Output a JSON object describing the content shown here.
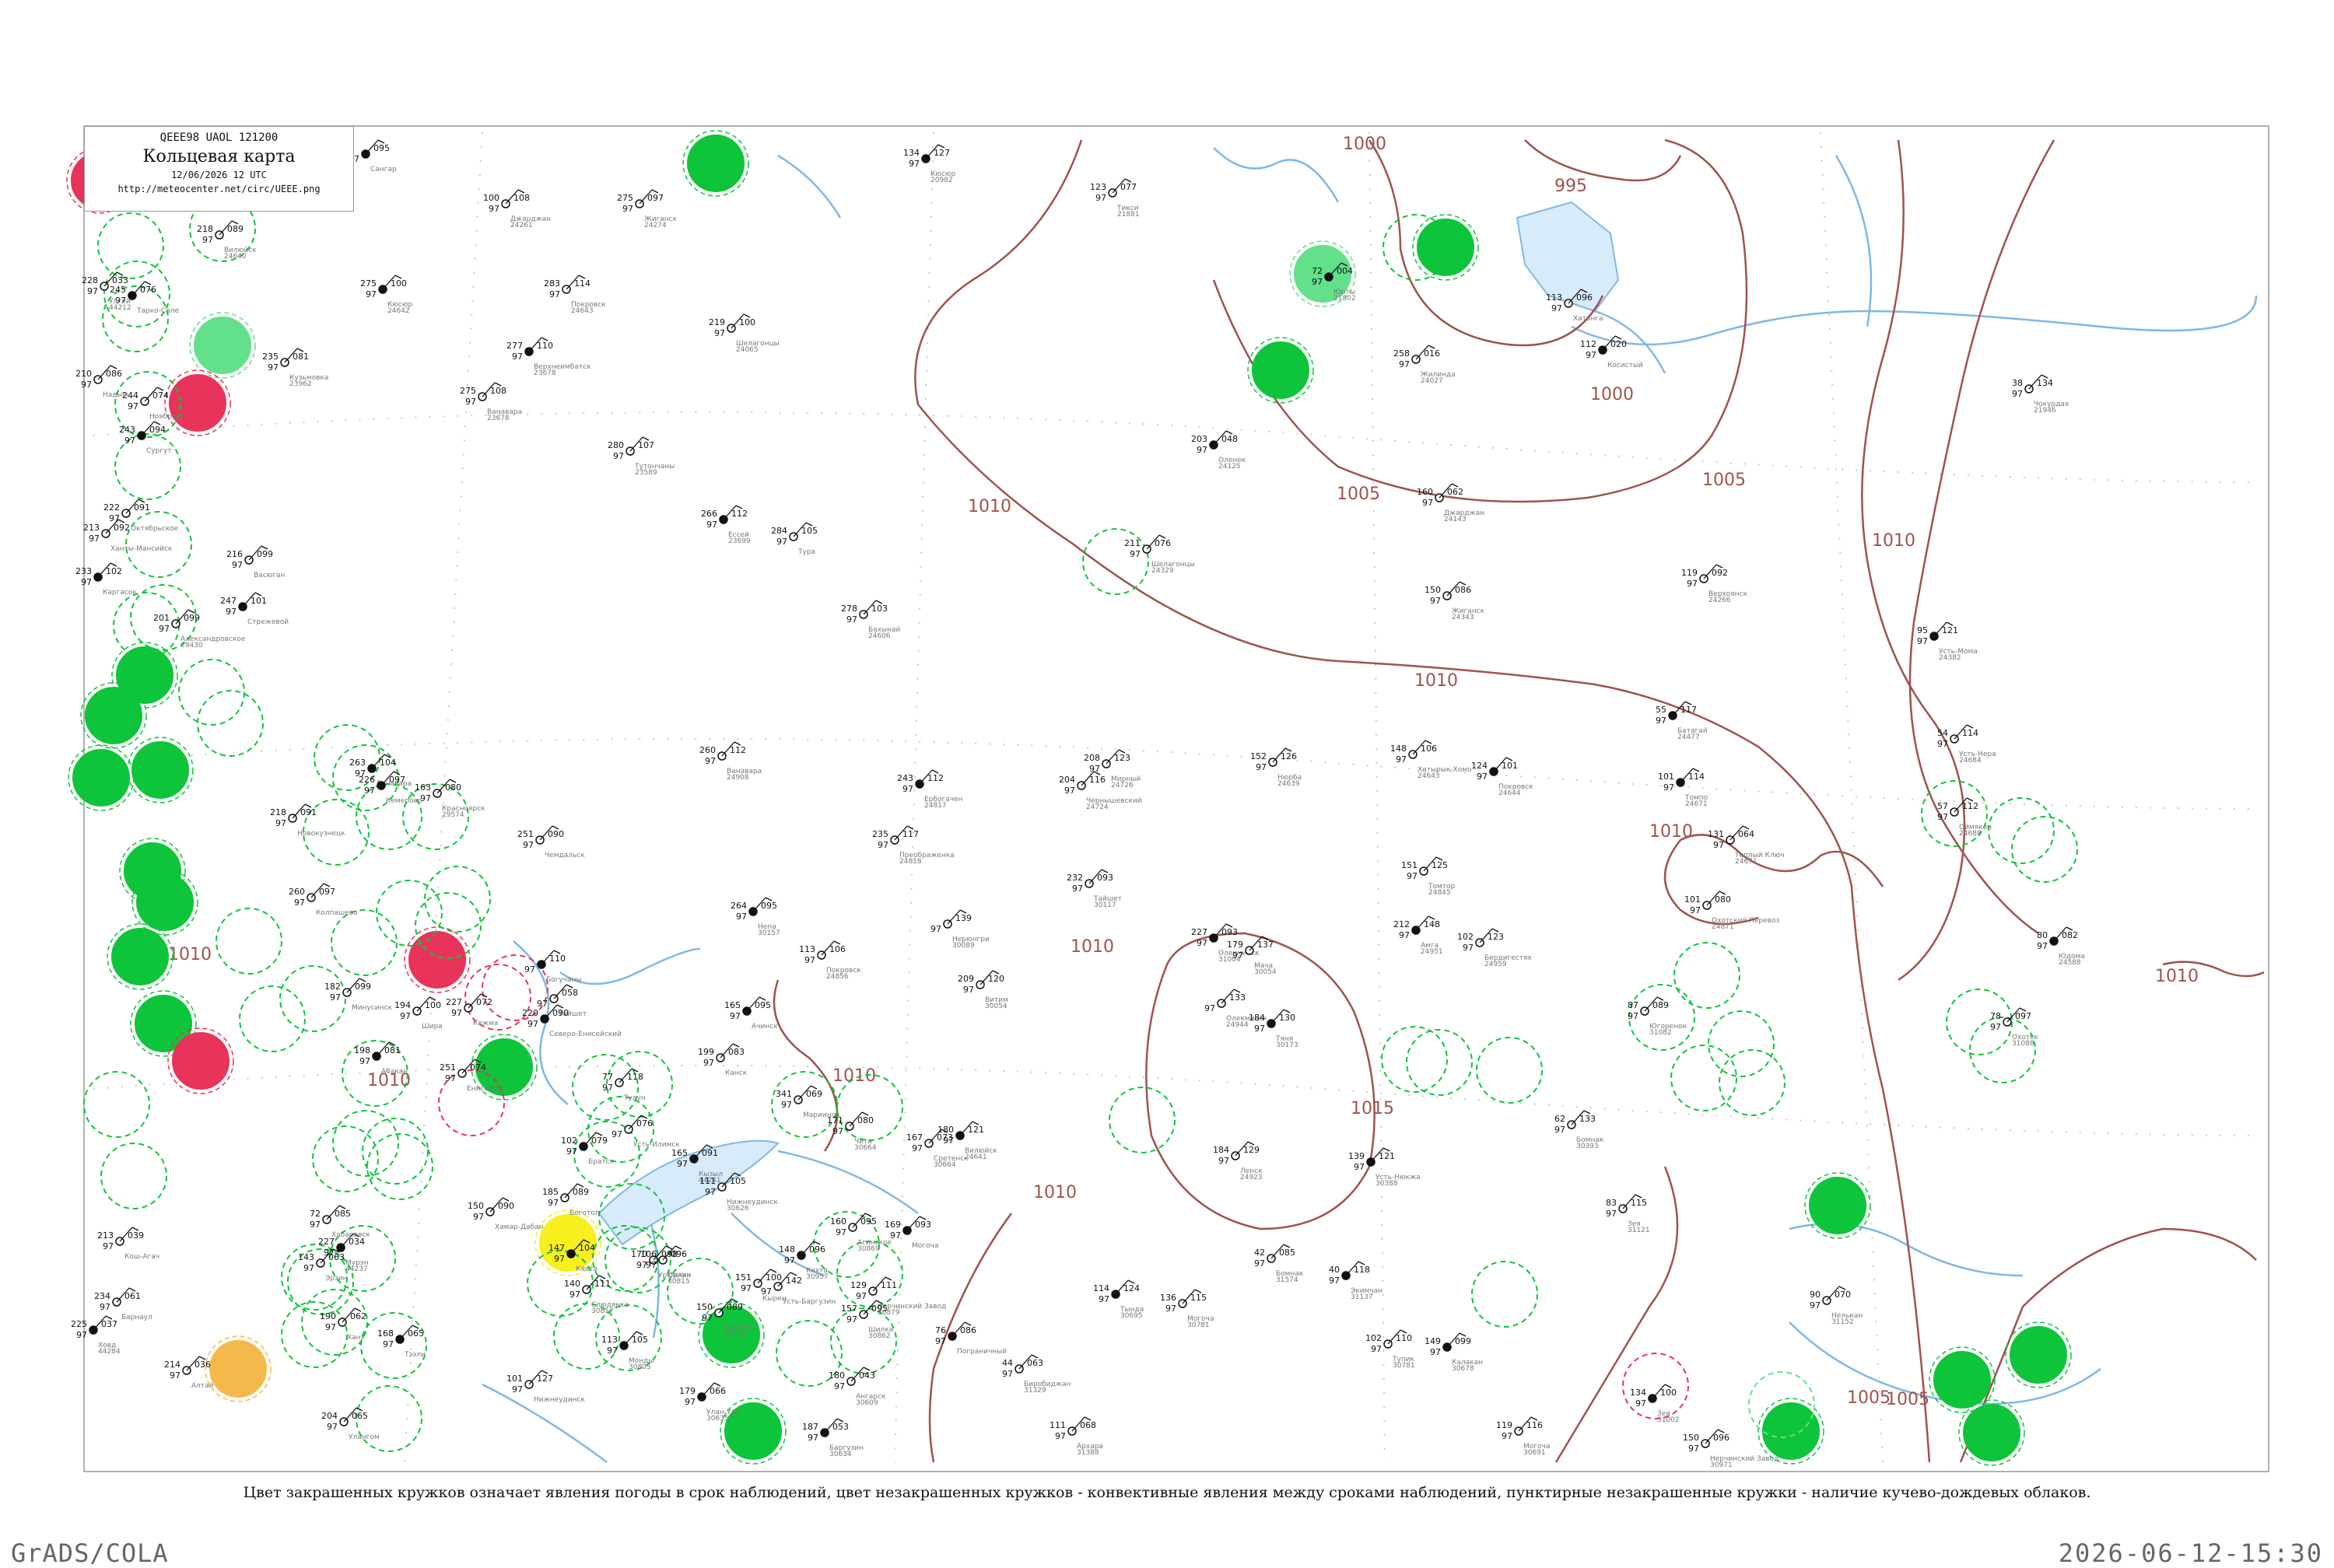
{
  "header": {
    "code_line": "QEEE98  UAOL  121200",
    "title": "Кольцевая карта",
    "datetime": "12/06/2026 12 UTC",
    "url": "http://meteocenter.net/circ/UEEE.png"
  },
  "caption": "Цвет закрашенных кружков означает явления погоды в срок наблюдений, цвет незакрашенных кружков - конвективные явления между сроками наблюдений, пунктирные незакрашенные кружки - наличие кучево-дождевых облаков.",
  "footer": {
    "left": "GrADS/COLA",
    "right": "2026-06-12-15:30"
  },
  "colors": {
    "isobar": "#a0524d",
    "water": "#7fb8e6",
    "frame": "#b0b0b0",
    "green_fill": "#0ec43a",
    "light_green_fill": "#63e08a",
    "red_fill": "#e8335a",
    "yellow_fill": "#f7ef1e",
    "orange_fill": "#f5b84a"
  },
  "isobar_labels": [
    "1000",
    "995",
    "1000",
    "1005",
    "1005",
    "1010",
    "1010",
    "1010",
    "1010",
    "1010",
    "1010",
    "1010",
    "1015",
    "1005",
    "1010",
    "1010",
    "1010",
    "1005"
  ],
  "stations": [
    {
      "p": "095",
      "t": "",
      "id": "",
      "name": "Сангар"
    },
    {
      "p": "108",
      "t": "100",
      "id": "24261",
      "name": "Джарджан"
    },
    {
      "p": "097",
      "t": "275",
      "id": "24274",
      "name": "Жиганск"
    },
    {
      "p": "127",
      "t": "134",
      "id": "20982",
      "name": "Кюсюр"
    },
    {
      "p": "077",
      "t": "123",
      "id": "21881",
      "name": "Тикси"
    },
    {
      "p": "089",
      "t": "218",
      "id": "24640",
      "name": "Вилюйск"
    },
    {
      "p": "100",
      "t": "275",
      "id": "24642",
      "name": "Кюсюр"
    },
    {
      "p": "114",
      "t": "283",
      "id": "24643",
      "name": "Покровск"
    },
    {
      "p": "100",
      "t": "219",
      "id": "24065",
      "name": "Шелагонцы"
    },
    {
      "p": "004",
      "t": "72",
      "id": "21802",
      "name": "Юрты"
    },
    {
      "p": "016",
      "t": "258",
      "id": "24027",
      "name": "Жилинда"
    },
    {
      "p": "096",
      "t": "113",
      "id": "",
      "name": "Хатанга"
    },
    {
      "p": "020",
      "t": "112",
      "id": "",
      "name": "Косистый"
    },
    {
      "p": "134",
      "t": "38",
      "id": "21946",
      "name": "Чокурдах"
    },
    {
      "p": "081",
      "t": "235",
      "id": "23962",
      "name": "Кузьмовка"
    },
    {
      "p": "110",
      "t": "277",
      "id": "23678",
      "name": "Верхнеимбатск"
    },
    {
      "p": "108",
      "t": "275",
      "id": "23678",
      "name": "Ванавара"
    },
    {
      "p": "107",
      "t": "280",
      "id": "23589",
      "name": "Тутончаны"
    },
    {
      "p": "112",
      "t": "266",
      "id": "23699",
      "name": "Ессей"
    },
    {
      "p": "105",
      "t": "284",
      "id": "",
      "name": "Тура"
    },
    {
      "p": "103",
      "t": "278",
      "id": "24606",
      "name": "Бахынай"
    },
    {
      "p": "048",
      "t": "203",
      "id": "24125",
      "name": "Оленек"
    },
    {
      "p": "062",
      "t": "160",
      "id": "24143",
      "name": "Джарджан"
    },
    {
      "p": "092",
      "t": "119",
      "id": "24266",
      "name": "Верхоянск"
    },
    {
      "p": "121",
      "t": "95",
      "id": "24382",
      "name": "Усть-Мома"
    },
    {
      "p": "086",
      "t": "150",
      "id": "24343",
      "name": "Жиганск"
    },
    {
      "p": "076",
      "t": "211",
      "id": "24329",
      "name": "Шелагонцы"
    },
    {
      "p": "117",
      "t": "55",
      "id": "24477",
      "name": "Батагай"
    },
    {
      "p": "114",
      "t": "54",
      "id": "24684",
      "name": "Усть-Нера"
    },
    {
      "p": "112",
      "t": "57",
      "id": "24688",
      "name": "Оймякон"
    },
    {
      "p": "114",
      "t": "101",
      "id": "24671",
      "name": "Томпо"
    },
    {
      "p": "064",
      "t": "131",
      "id": "24671",
      "name": "Теплый Ключ"
    },
    {
      "p": "080",
      "t": "101",
      "id": "24871",
      "name": "Охотский Перевоз"
    },
    {
      "p": "082",
      "t": "80",
      "id": "24588",
      "name": "Юдома"
    },
    {
      "p": "089",
      "t": "87",
      "id": "31082",
      "name": "Югоренок"
    },
    {
      "p": "097",
      "t": "78",
      "id": "31088",
      "name": "Охотск"
    },
    {
      "p": "121",
      "t": "180",
      "id": "24641",
      "name": "Вилюйск"
    },
    {
      "p": "126",
      "t": "152",
      "id": "24639",
      "name": "Нюрба"
    },
    {
      "p": "106",
      "t": "148",
      "id": "24643",
      "name": "Хатырык-Хомо"
    },
    {
      "p": "101",
      "t": "124",
      "id": "24644",
      "name": "Покровск"
    },
    {
      "p": "123",
      "t": "208",
      "id": "24726",
      "name": "Мирный"
    },
    {
      "p": "116",
      "t": "204",
      "id": "24724",
      "name": "Чернышевский"
    },
    {
      "p": "112",
      "t": "243",
      "id": "24817",
      "name": "Ербогачен"
    },
    {
      "p": "117",
      "t": "235",
      "id": "24818",
      "name": "Преображенка"
    },
    {
      "p": "112",
      "t": "260",
      "id": "24908",
      "name": "Ванавара"
    },
    {
      "p": "104",
      "t": "263",
      "id": "",
      "name": "Ванавара"
    },
    {
      "p": "090",
      "t": "251",
      "id": "",
      "name": "Чемдальск"
    },
    {
      "p": "125",
      "t": "151",
      "id": "24845",
      "name": "Томтор"
    },
    {
      "p": "148",
      "t": "212",
      "id": "24951",
      "name": "Амга"
    },
    {
      "p": "123",
      "t": "102",
      "id": "24959",
      "name": "Бердигестях"
    },
    {
      "p": "106",
      "t": "113",
      "id": "24856",
      "name": "Покровск"
    },
    {
      "p": "093",
      "t": "227",
      "id": "31004",
      "name": "Олекминск"
    },
    {
      "p": "137",
      "t": "179",
      "id": "30054",
      "name": "Мача"
    },
    {
      "p": "133",
      "t": "",
      "id": "24944",
      "name": "Олекминск"
    },
    {
      "p": "130",
      "t": "184",
      "id": "30173",
      "name": "Тяня"
    },
    {
      "p": "139",
      "t": "",
      "id": "30089",
      "name": "Нерюнгри"
    },
    {
      "p": "120",
      "t": "209",
      "id": "30054",
      "name": "Витим"
    },
    {
      "p": "095",
      "t": "264",
      "id": "30157",
      "name": "Непа"
    },
    {
      "p": "093",
      "t": "232",
      "id": "30117",
      "name": "Тайшет"
    },
    {
      "p": "129",
      "t": "184",
      "id": "24923",
      "name": "Ленск"
    },
    {
      "p": "121",
      "t": "139",
      "id": "30388",
      "name": "Усть-Нюкжа"
    },
    {
      "p": "133",
      "t": "62",
      "id": "30393",
      "name": "Бомнак"
    },
    {
      "p": "115",
      "t": "83",
      "id": "31121",
      "name": "Зея"
    },
    {
      "p": "118",
      "t": "40",
      "id": "31137",
      "name": "Экимчан"
    },
    {
      "p": "070",
      "t": "90",
      "id": "31152",
      "name": "Нелькан"
    },
    {
      "p": "085",
      "t": "42",
      "id": "31574",
      "name": "Бомнак"
    },
    {
      "p": "124",
      "t": "114",
      "id": "30695",
      "name": "Тында"
    },
    {
      "p": "115",
      "t": "136",
      "id": "30781",
      "name": "Могоча"
    },
    {
      "p": "110",
      "t": "102",
      "id": "30781",
      "name": "Тупик"
    },
    {
      "p": "099",
      "t": "149",
      "id": "30678",
      "name": "Калакан"
    },
    {
      "p": "116",
      "t": "119",
      "id": "30691",
      "name": "Могоча"
    },
    {
      "p": "096",
      "t": "150",
      "id": "30971",
      "name": "Нерчинский Завод"
    },
    {
      "p": "100",
      "t": "134",
      "id": "31002",
      "name": "Зея"
    },
    {
      "p": "068",
      "t": "111",
      "id": "31388",
      "name": "Архара"
    },
    {
      "p": "063",
      "t": "44",
      "id": "31329",
      "name": "Биробиджан"
    },
    {
      "p": "086",
      "t": "76",
      "id": "",
      "name": "Пограничный"
    },
    {
      "p": "111",
      "t": "129",
      "id": "30879",
      "name": "Нерчинский Завод"
    },
    {
      "p": "095",
      "t": "157",
      "id": "30862",
      "name": "Шилка"
    },
    {
      "p": "093",
      "t": "169",
      "id": "",
      "name": "Могоча"
    },
    {
      "p": "073",
      "t": "167",
      "id": "30664",
      "name": "Сретенск"
    },
    {
      "p": "080",
      "t": "171",
      "id": "30664",
      "name": "Чита"
    },
    {
      "p": "053",
      "t": "187",
      "id": "30634",
      "name": "Баргузин"
    },
    {
      "p": "043",
      "t": "180",
      "id": "30609",
      "name": "Ангарск"
    },
    {
      "p": "142",
      "t": "",
      "id": "",
      "name": "Усть-Баргузин"
    },
    {
      "p": "096",
      "t": "148",
      "id": "30957",
      "name": "Кяхта"
    },
    {
      "p": "095",
      "t": "160",
      "id": "30869",
      "name": "Агинское"
    },
    {
      "p": "089",
      "t": "150",
      "id": "30710",
      "name": "Иркутск"
    },
    {
      "p": "066",
      "t": "179",
      "id": "30635",
      "name": "Улан-Удэ"
    },
    {
      "p": "098",
      "t": "170",
      "id": "",
      "name": "Урюмкан"
    },
    {
      "p": "100",
      "t": "151",
      "id": "",
      "name": "Кырен"
    },
    {
      "p": "105",
      "t": "113",
      "id": "30805",
      "name": "Монды"
    },
    {
      "p": "111",
      "t": "140",
      "id": "30817",
      "name": "Слюдянка"
    },
    {
      "p": "090",
      "t": "150",
      "id": "",
      "name": "Хамар-Дабан"
    },
    {
      "p": "104",
      "t": "147",
      "id": "",
      "name": "Кяхта"
    },
    {
      "p": "127",
      "t": "101",
      "id": "",
      "name": "Нижнеудинск"
    },
    {
      "p": "096",
      "t": "106",
      "id": "30815",
      "name": "Орлик"
    },
    {
      "p": "091",
      "t": "165",
      "id": "44241",
      "name": "Кызыл"
    },
    {
      "p": "105",
      "t": "111",
      "id": "30626",
      "name": "Нижнеудинск"
    },
    {
      "p": "118",
      "t": "77",
      "id": "",
      "name": "Тулун"
    },
    {
      "p": "079",
      "t": "102",
      "id": "",
      "name": "Братск"
    },
    {
      "p": "076",
      "t": "",
      "id": "",
      "name": "Усть-Илимск"
    },
    {
      "p": "089",
      "t": "185",
      "id": "",
      "name": "Боготол"
    },
    {
      "p": "095",
      "t": "165",
      "id": "",
      "name": "Ачинск"
    },
    {
      "p": "083",
      "t": "199",
      "id": "",
      "name": "Канск"
    },
    {
      "p": "058",
      "t": "",
      "id": "",
      "name": "Тайшет"
    },
    {
      "p": "110",
      "t": "",
      "id": "",
      "name": "Богучаны"
    },
    {
      "p": "074",
      "t": "251",
      "id": "",
      "name": "Енисейск"
    },
    {
      "p": "072",
      "t": "227",
      "id": "",
      "name": "Кежма"
    },
    {
      "p": "090",
      "t": "220",
      "id": "",
      "name": "Северо-Енисейский"
    },
    {
      "p": "069",
      "t": "341",
      "id": "",
      "name": "Мариинск"
    },
    {
      "p": "080",
      "t": "163",
      "id": "29574",
      "name": "Красноярск"
    },
    {
      "p": "081",
      "t": "198",
      "id": "",
      "name": "Абакан"
    },
    {
      "p": "099",
      "t": "182",
      "id": "",
      "name": "Минусинск"
    },
    {
      "p": "100",
      "t": "194",
      "id": "",
      "name": "Шира"
    },
    {
      "p": "097",
      "t": "226",
      "id": "",
      "name": "Кемерово"
    },
    {
      "p": "091",
      "t": "218",
      "id": "",
      "name": "Новокузнецк"
    },
    {
      "p": "097",
      "t": "260",
      "id": "",
      "name": "Колпашево"
    },
    {
      "p": "102",
      "t": "233",
      "id": "",
      "name": "Каргасок"
    },
    {
      "p": "099",
      "t": "201",
      "id": "29430",
      "name": "Александровское"
    },
    {
      "p": "099",
      "t": "216",
      "id": "",
      "name": "Васюган"
    },
    {
      "p": "101",
      "t": "247",
      "id": "",
      "name": "Стрежевой"
    },
    {
      "p": "092",
      "t": "213",
      "id": "",
      "name": "Ханты-Мансийск"
    },
    {
      "p": "091",
      "t": "222",
      "id": "",
      "name": "Октябрьское"
    },
    {
      "p": "094",
      "t": "243",
      "id": "",
      "name": "Сургут"
    },
    {
      "p": "074",
      "t": "244",
      "id": "",
      "name": "Ноябрьск"
    },
    {
      "p": "086",
      "t": "210",
      "id": "",
      "name": "Надым"
    },
    {
      "p": "076",
      "t": "245",
      "id": "",
      "name": "Тарко-Сале"
    },
    {
      "p": "033",
      "t": "228",
      "id": "44212",
      "name": "Улгий"
    },
    {
      "p": "039",
      "t": "213",
      "id": "",
      "name": "Кош-Агач"
    },
    {
      "p": "037",
      "t": "225",
      "id": "44284",
      "name": "Ховд"
    },
    {
      "p": "036",
      "t": "214",
      "id": "",
      "name": "Алтай"
    },
    {
      "p": "061",
      "t": "234",
      "id": "",
      "name": "Барнаул"
    },
    {
      "p": "034",
      "t": "227",
      "id": "44237",
      "name": "Мурэн"
    },
    {
      "p": "062",
      "t": "190",
      "id": "",
      "name": "Ханх"
    },
    {
      "p": "065",
      "t": "204",
      "id": "",
      "name": "Улангом"
    },
    {
      "p": "065",
      "t": "168",
      "id": "",
      "name": "Тээли"
    },
    {
      "p": "063",
      "t": "143",
      "id": "",
      "name": "Эрзин"
    },
    {
      "p": "085",
      "t": "72",
      "id": "",
      "name": "Хабаровск"
    }
  ]
}
